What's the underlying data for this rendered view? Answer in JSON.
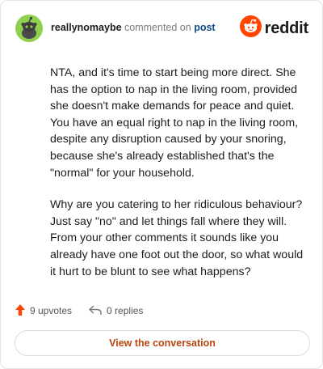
{
  "comment": {
    "username": "reallynomaybe",
    "action_text": "commented on",
    "post_link": "post",
    "body": [
      "NTA, and it's time to start being more direct. She has the option to nap in the living room, provided she doesn't make demands for peace and quiet. You have an equal right to nap in the living room, despite any disruption caused by your snoring, because she's already established that's the \"normal\" for your household.",
      "Why are you catering to her ridiculous behaviour? Just say \"no\" and let things fall where they will. From your other comments it sounds like you already have one foot out the door, so what would it hurt to be blunt to see what happens?"
    ],
    "upvotes": "9 upvotes",
    "replies": "0 replies",
    "cta": "View the conversation"
  },
  "brand": {
    "wordmark": "reddit",
    "color": "#ff4500"
  },
  "icons": {
    "avatar": "snoo-avatar-icon",
    "upvote": "upvote-arrow-icon",
    "reply": "reply-arrow-icon",
    "logo": "reddit-logo-icon"
  }
}
